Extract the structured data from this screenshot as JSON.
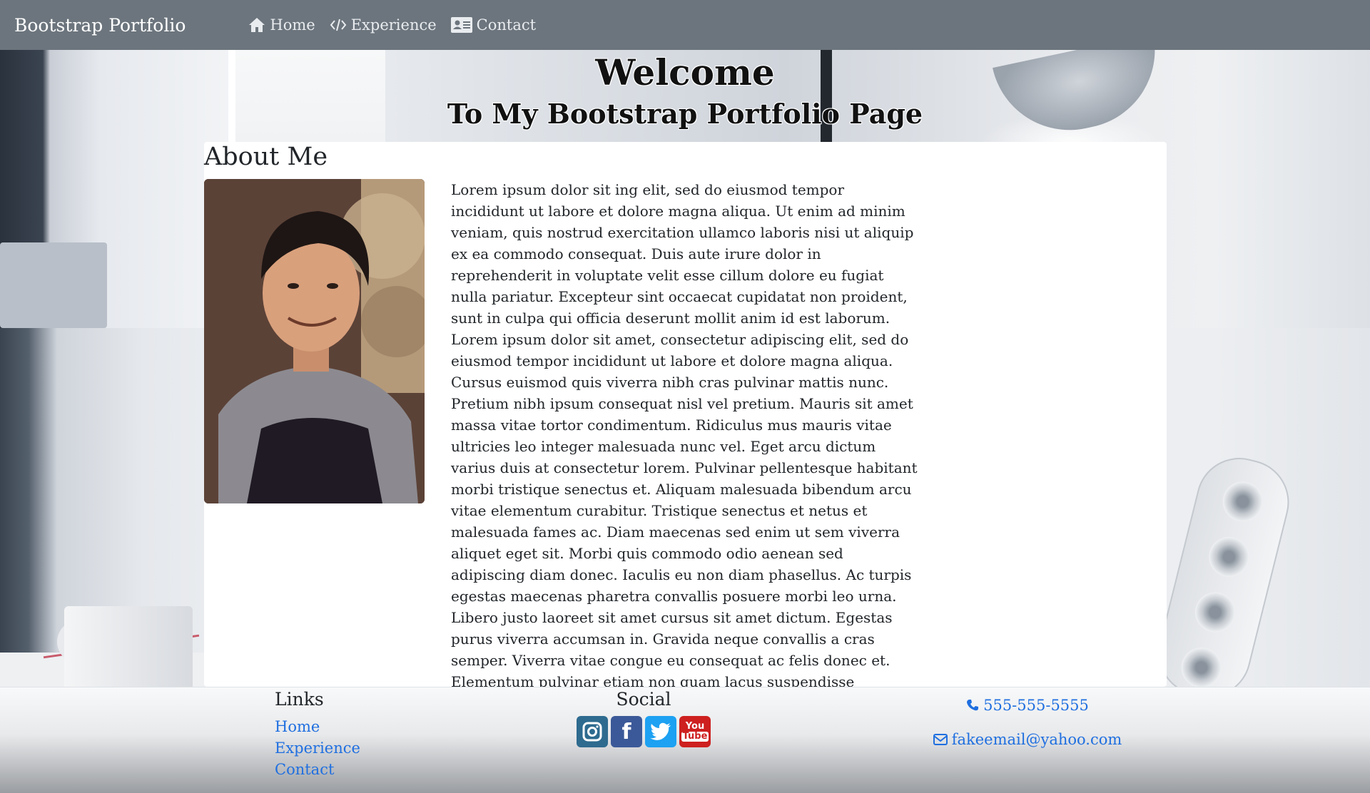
{
  "navbar": {
    "brand": "Bootstrap Portfolio",
    "links": [
      {
        "label": "Home",
        "icon": "home-icon"
      },
      {
        "label": "Experience",
        "icon": "code-icon"
      },
      {
        "label": "Contact",
        "icon": "address-card-icon"
      }
    ]
  },
  "hero": {
    "title": "Welcome",
    "subtitle": "To My Bootstrap Portfolio Page"
  },
  "about": {
    "heading": "About Me",
    "photo_icon": "portrait-photo",
    "text": "Lorem ipsum dolor sit ing elit, sed do eiusmod tempor incididunt ut labore et dolore magna aliqua. Ut enim ad minim veniam, quis nostrud exercitation ullamco laboris nisi ut aliquip ex ea commodo consequat. Duis aute irure dolor in reprehenderit in voluptate velit esse cillum dolore eu fugiat nulla pariatur. Excepteur sint occaecat cupidatat non proident, sunt in culpa qui officia deserunt mollit anim id est laborum. Lorem ipsum dolor sit amet, consectetur adipiscing elit, sed do eiusmod tempor incididunt ut labore et dolore magna aliqua. Cursus euismod quis viverra nibh cras pulvinar mattis nunc. Pretium nibh ipsum consequat nisl vel pretium. Mauris sit amet massa vitae tortor condimentum. Ridiculus mus mauris vitae ultricies leo integer malesuada nunc vel. Eget arcu dictum varius duis at consectetur lorem. Pulvinar pellentesque habitant morbi tristique senectus et. Aliquam malesuada bibendum arcu vitae elementum curabitur. Tristique senectus et netus et malesuada fames ac. Diam maecenas sed enim ut sem viverra aliquet eget sit. Morbi quis commodo odio aenean sed adipiscing diam donec. Iaculis eu non diam phasellus. Ac turpis egestas maecenas pharetra convallis posuere morbi leo urna. Libero justo laoreet sit amet cursus sit amet dictum. Egestas purus viverra accumsan in. Gravida neque convallis a cras semper. Viverra vitae congue eu consequat ac felis donec et. Elementum pulvinar etiam non quam lacus suspendisse faucibus. Nullam non nisi est sit amet facilisis magna etiam tempor."
  },
  "footer": {
    "links_heading": "Links",
    "links": [
      "Home",
      "Experience",
      "Contact"
    ],
    "social_heading": "Social",
    "social": [
      {
        "name": "instagram-icon",
        "glyph": "◎",
        "color": "#2e6b8f"
      },
      {
        "name": "facebook-icon",
        "glyph": "f",
        "color": "#3b5998"
      },
      {
        "name": "twitter-icon",
        "glyph": "t",
        "color": "#1da1f2"
      },
      {
        "name": "youtube-icon",
        "glyph": "You Tube",
        "color": "#cd201f"
      }
    ],
    "phone": "555-555-5555",
    "email": "fakeemail@yahoo.com"
  },
  "colors": {
    "navbar": "#6c757d",
    "link": "#1f6fe0"
  }
}
